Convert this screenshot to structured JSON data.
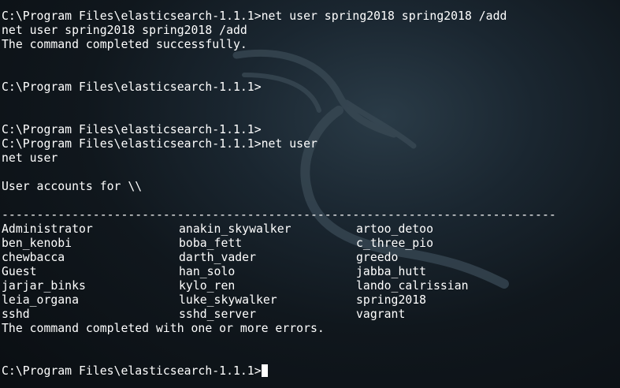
{
  "terminal": {
    "lines": [
      "C:\\Program Files\\elasticsearch-1.1.1>net user spring2018 spring2018 /add",
      "net user spring2018 spring2018 /add",
      "The command completed successfully.",
      "",
      "",
      "C:\\Program Files\\elasticsearch-1.1.1>",
      "",
      "",
      "C:\\Program Files\\elasticsearch-1.1.1>",
      "C:\\Program Files\\elasticsearch-1.1.1>net user",
      "net user",
      "",
      "User accounts for \\\\",
      "",
      "-------------------------------------------------------------------------------"
    ],
    "accounts": [
      [
        "Administrator",
        "anakin_skywalker",
        "artoo_detoo"
      ],
      [
        "ben_kenobi",
        "boba_fett",
        "c_three_pio"
      ],
      [
        "chewbacca",
        "darth_vader",
        "greedo"
      ],
      [
        "Guest",
        "han_solo",
        "jabba_hutt"
      ],
      [
        "jarjar_binks",
        "kylo_ren",
        "lando_calrissian"
      ],
      [
        "leia_organa",
        "luke_skywalker",
        "spring2018"
      ],
      [
        "sshd",
        "sshd_server",
        "vagrant"
      ]
    ],
    "completion_message": "The command completed with one or more errors.",
    "prompt": "C:\\Program Files\\elasticsearch-1.1.1>"
  },
  "colors": {
    "text": "#ffffff",
    "background": "#0b0f14"
  },
  "wallpaper_icon": "kali-dragon-icon"
}
